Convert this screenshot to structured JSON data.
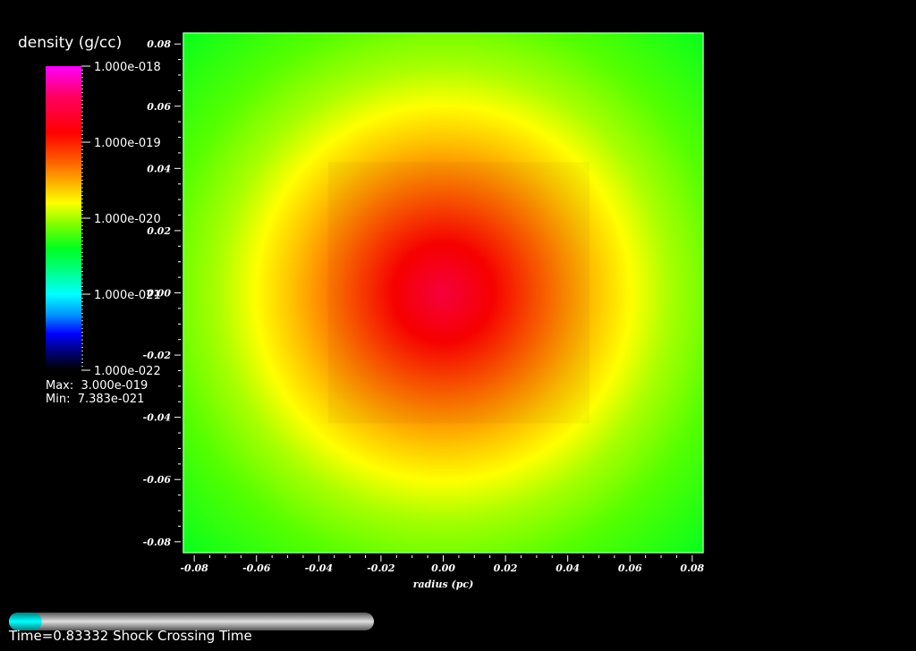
{
  "chart_data": {
    "type": "heatmap",
    "variable": "density (g/cc)",
    "xlabel": "radius (pc)",
    "ylabel": "",
    "xlim": [
      -0.0835,
      0.0835
    ],
    "ylim": [
      -0.0835,
      0.0835
    ],
    "x_ticks": [
      "-0.08",
      "-0.06",
      "-0.04",
      "-0.02",
      "0.00",
      "0.02",
      "0.04",
      "0.06",
      "0.08"
    ],
    "y_ticks": [
      "-0.08",
      "-0.06",
      "-0.04",
      "-0.02",
      "0.00",
      "0.02",
      "0.04",
      "0.06",
      "0.08"
    ],
    "x_tick_values": [
      -0.08,
      -0.06,
      -0.04,
      -0.02,
      0.0,
      0.02,
      0.04,
      0.06,
      0.08
    ],
    "y_tick_values": [
      -0.08,
      -0.06,
      -0.04,
      -0.02,
      0.0,
      0.02,
      0.04,
      0.06,
      0.08
    ],
    "center": [
      0.0,
      0.0
    ],
    "colorbar": {
      "scale": "log",
      "labels": [
        "1.000e-018",
        "1.000e-019",
        "1.000e-020",
        "1.000e-021",
        "1.000e-022"
      ],
      "exponents": [
        -18,
        -19,
        -20,
        -21,
        -22
      ],
      "colors": [
        {
          "pos": 0.0,
          "color": "#ff00ff"
        },
        {
          "pos": 0.1,
          "color": "#ff0060"
        },
        {
          "pos": 0.22,
          "color": "#ff0000"
        },
        {
          "pos": 0.3,
          "color": "#ff5000"
        },
        {
          "pos": 0.37,
          "color": "#ffa000"
        },
        {
          "pos": 0.45,
          "color": "#ffff00"
        },
        {
          "pos": 0.52,
          "color": "#80ff00"
        },
        {
          "pos": 0.6,
          "color": "#00ff20"
        },
        {
          "pos": 0.67,
          "color": "#00ff80"
        },
        {
          "pos": 0.75,
          "color": "#00ffff"
        },
        {
          "pos": 0.82,
          "color": "#0090ff"
        },
        {
          "pos": 0.88,
          "color": "#0000ff"
        },
        {
          "pos": 0.95,
          "color": "#000060"
        },
        {
          "pos": 1.0,
          "color": "#000000"
        }
      ]
    },
    "max_label": "Max:  3.000e-019",
    "min_label": "Min:  7.383e-021",
    "max_value": 3e-19,
    "min_value": 7.383e-21,
    "frame_color": "#90ff90"
  },
  "time_label": "Time=0.83332 Shock Crossing Time",
  "time_progress": 0.09
}
